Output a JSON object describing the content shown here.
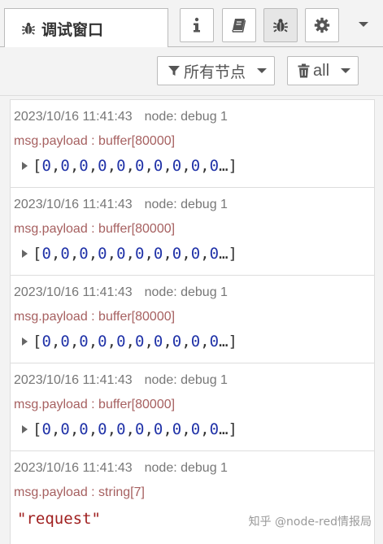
{
  "header": {
    "tab_label": "调试窗口",
    "tab_icon": "bug-icon",
    "buttons": [
      {
        "name": "info-button",
        "icon": "info-icon"
      },
      {
        "name": "help-button",
        "icon": "book-icon"
      },
      {
        "name": "debug-button",
        "icon": "bug-icon",
        "selected": true
      },
      {
        "name": "config-button",
        "icon": "gear-icon"
      }
    ],
    "menu_icon": "chevron-down-icon"
  },
  "toolbar": {
    "filter_label": "所有节点",
    "clear_label": "all"
  },
  "messages": [
    {
      "timestamp": "2023/10/16 11:41:43",
      "node": "node: debug 1",
      "topic": "msg.payload : buffer[80000]",
      "type": "buffer",
      "values": [
        "0",
        "0",
        "0",
        "0",
        "0",
        "0",
        "0",
        "0",
        "0",
        "0"
      ],
      "ellipsis": "…"
    },
    {
      "timestamp": "2023/10/16 11:41:43",
      "node": "node: debug 1",
      "topic": "msg.payload : buffer[80000]",
      "type": "buffer",
      "values": [
        "0",
        "0",
        "0",
        "0",
        "0",
        "0",
        "0",
        "0",
        "0",
        "0"
      ],
      "ellipsis": "…"
    },
    {
      "timestamp": "2023/10/16 11:41:43",
      "node": "node: debug 1",
      "topic": "msg.payload : buffer[80000]",
      "type": "buffer",
      "values": [
        "0",
        "0",
        "0",
        "0",
        "0",
        "0",
        "0",
        "0",
        "0",
        "0"
      ],
      "ellipsis": "…"
    },
    {
      "timestamp": "2023/10/16 11:41:43",
      "node": "node: debug 1",
      "topic": "msg.payload : buffer[80000]",
      "type": "buffer",
      "values": [
        "0",
        "0",
        "0",
        "0",
        "0",
        "0",
        "0",
        "0",
        "0",
        "0"
      ],
      "ellipsis": "…"
    },
    {
      "timestamp": "2023/10/16 11:41:43",
      "node": "node: debug 1",
      "topic": "msg.payload : string[7]",
      "type": "string",
      "value": "\"request\""
    }
  ],
  "watermark": "知乎 @node-red情报局",
  "colors": {
    "timestamp": "#777777",
    "topic": "#a66060",
    "number": "#2133a8",
    "string": "#a02020",
    "panel_bg": "#f3f3f3",
    "border": "#bbbbbb"
  }
}
